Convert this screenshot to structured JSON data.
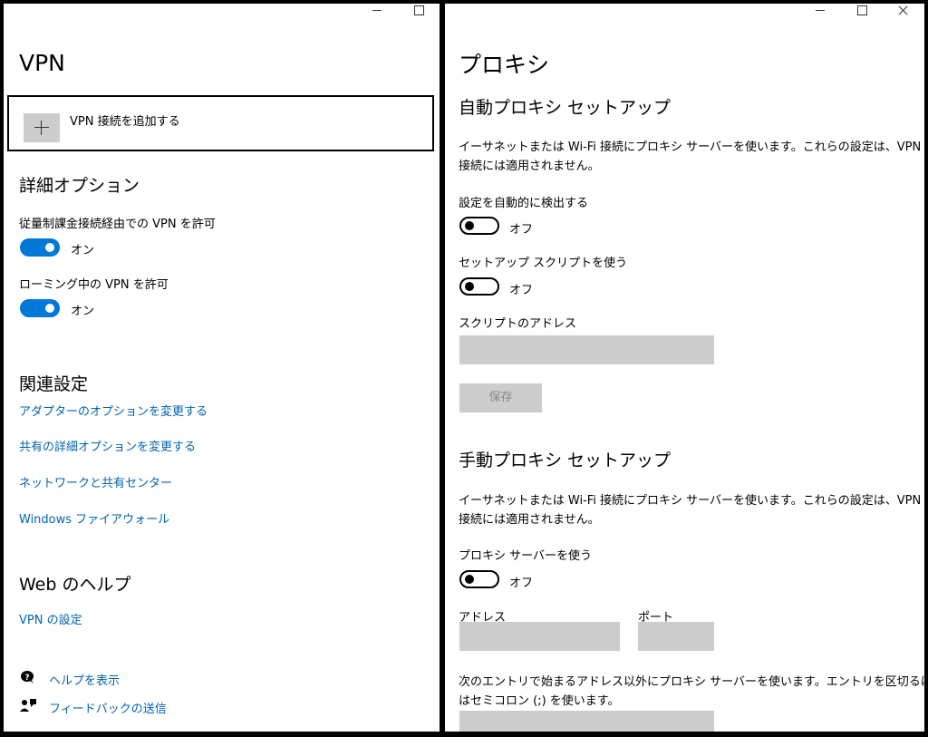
{
  "vpn": {
    "title": "VPN",
    "add_vpn_label": "VPN 接続を追加する",
    "advanced_heading": "詳細オプション",
    "metered_label": "従量制課金接続経由での VPN を許可",
    "metered_state": "オン",
    "roaming_label": "ローミング中の VPN を許可",
    "roaming_state": "オン",
    "related_heading": "関連設定",
    "related_links": [
      "アダプターのオプションを変更する",
      "共有の詳細オプションを変更する",
      "ネットワークと共有センター",
      "Windows ファイアウォール"
    ],
    "web_help_heading": "Web のヘルプ",
    "web_help_link": "VPN の設定",
    "help_label": "ヘルプを表示",
    "feedback_label": "フィードバックの送信"
  },
  "proxy": {
    "title": "プロキシ",
    "auto_heading": "自動プロキシ セットアップ",
    "auto_desc_line1": "イーサネットまたは Wi-Fi 接続にプロキシ サーバーを使います。これらの設定は、VPN",
    "auto_desc_line2": "接続には適用されません。",
    "auto_detect_label": "設定を自動的に検出する",
    "auto_detect_state": "オフ",
    "setup_script_label": "セットアップ スクリプトを使う",
    "setup_script_state": "オフ",
    "script_address_label": "スクリプトのアドレス",
    "save_label": "保存",
    "manual_heading": "手動プロキシ セットアップ",
    "manual_desc_line1": "イーサネットまたは Wi-Fi 接続にプロキシ サーバーを使います。これらの設定は、VPN",
    "manual_desc_line2": "接続には適用されません。",
    "use_proxy_label": "プロキシ サーバーを使う",
    "use_proxy_state": "オフ",
    "address_label": "アドレス",
    "port_label": "ポート",
    "exceptions_line1": "次のエントリで始まるアドレス以外にプロキシ サーバーを使います。エントリを区切るに",
    "exceptions_line2": "はセミコロン (;) を使います。"
  },
  "colors": {
    "accent": "#0078d7",
    "link": "#0063b1",
    "field": "#cccccc"
  }
}
